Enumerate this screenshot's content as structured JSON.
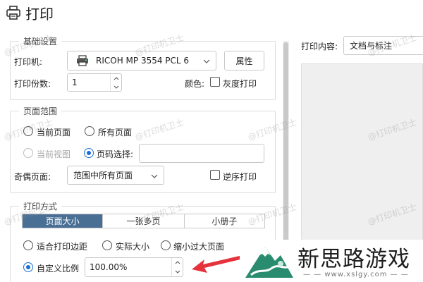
{
  "window": {
    "title": "打印"
  },
  "basic": {
    "legend": "基础设置",
    "printer_label": "打印机:",
    "printer_value": "RICOH MP 3554 PCL 6",
    "properties_button": "属性",
    "copies_label": "打印份数:",
    "copies_value": "1",
    "color_label": "颜色:",
    "grayscale_label": "灰度打印",
    "grayscale_checked": false
  },
  "page_range": {
    "legend": "页面范围",
    "current_page": "当前页面",
    "all_pages": "所有页面",
    "current_view": "当前视图",
    "page_select": "页码选择:",
    "page_select_value": "",
    "odd_even_label": "奇偶页面:",
    "odd_even_value": "范围中所有页面",
    "reverse_label": "逆序打印",
    "selected": "page_select"
  },
  "print_mode": {
    "legend": "打印方式",
    "tabs": [
      "页面大小",
      "一张多页",
      "小册子"
    ],
    "active_tab": 0,
    "fit_margins": "适合打印边距",
    "actual_size": "实际大小",
    "shrink_oversized": "缩小过大页面",
    "custom_scale": "自定义比例",
    "custom_scale_value": "100.00%",
    "selected": "custom_scale"
  },
  "right_panel": {
    "content_label": "打印内容:",
    "content_value": "文档与标注"
  },
  "watermark": "@打印机卫士",
  "logo": {
    "text": "新思路游戏",
    "url": "— — www.xslgy.com — —"
  },
  "colors": {
    "accent": "#1a6fd1",
    "active_tab": "#4a6f94",
    "arrow": "#e5323b"
  }
}
